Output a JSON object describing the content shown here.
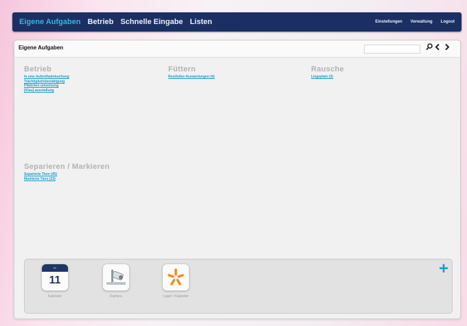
{
  "nav": {
    "left": [
      "Eigene Aufgaben",
      "Betrieb",
      "Schnelle Eingabe",
      "Listen"
    ],
    "right": [
      "Einstellungen",
      "Verwaltung",
      "Logout"
    ],
    "active_color": "#34b5dd",
    "bar_color": "#1c2f63"
  },
  "panel": {
    "title": "Eigene Aufgaben",
    "search_value": "",
    "icons": [
      "search-icon",
      "chevron-left-icon",
      "chevron-right-icon"
    ]
  },
  "sections": {
    "betrieb": {
      "title": "Betrieb",
      "links": [
        "In eine Aufenthaltsbuchung",
        "Trächtigkeitsbestätigung",
        "Pfädchen umsetzung",
        "[Klau]-ausstallung"
      ]
    },
    "fuettern": {
      "title": "Füttern",
      "links": [
        "Restfutter-Auswertungen (4)"
      ]
    },
    "rausche": {
      "title": "Rausche",
      "links": [
        "Liegeplatz (3)"
      ]
    },
    "separieren": {
      "title": "Separieren / Markieren",
      "links": [
        "Separierte Tiere (45)",
        "Markierte Tiere (33)"
      ]
    }
  },
  "dock": {
    "apps": [
      {
        "label": "Kalender",
        "day": "11",
        "month": "Fr",
        "icon": "calendar-icon"
      },
      {
        "label": "Kamera",
        "icon": "camera-icon"
      },
      {
        "label": "Lager / Kalender",
        "icon": "star-icon"
      }
    ],
    "accent": "#1a9ccc"
  }
}
